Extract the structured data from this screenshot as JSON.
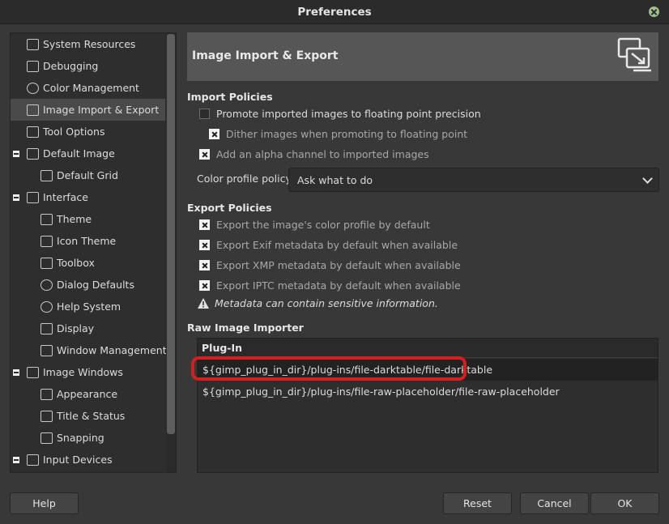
{
  "window": {
    "title": "Preferences"
  },
  "sidebar": {
    "items": [
      {
        "label": "System Resources"
      },
      {
        "label": "Debugging"
      },
      {
        "label": "Color Management"
      },
      {
        "label": "Image Import & Export"
      },
      {
        "label": "Tool Options"
      },
      {
        "label": "Default Image"
      },
      {
        "label": "Default Grid"
      },
      {
        "label": "Interface"
      },
      {
        "label": "Theme"
      },
      {
        "label": "Icon Theme"
      },
      {
        "label": "Toolbox"
      },
      {
        "label": "Dialog Defaults"
      },
      {
        "label": "Help System"
      },
      {
        "label": "Display"
      },
      {
        "label": "Window Management"
      },
      {
        "label": "Image Windows"
      },
      {
        "label": "Appearance"
      },
      {
        "label": "Title & Status"
      },
      {
        "label": "Snapping"
      },
      {
        "label": "Input Devices"
      }
    ],
    "selected": "Image Import & Export"
  },
  "page": {
    "title": "Image Import & Export",
    "import_policies": {
      "title": "Import Policies",
      "promote": {
        "label": "Promote imported images to floating point precision",
        "checked": false
      },
      "dither": {
        "label": "Dither images when promoting to floating point",
        "checked": true
      },
      "alpha": {
        "label": "Add an alpha channel to imported images",
        "checked": true
      },
      "color_profile_label": "Color profile policy:",
      "color_profile_value": "Ask what to do"
    },
    "export_policies": {
      "title": "Export Policies",
      "profile": {
        "label": "Export the image's color profile by default",
        "checked": true
      },
      "exif": {
        "label": "Export Exif metadata by default when available",
        "checked": true
      },
      "xmp": {
        "label": "Export XMP metadata by default when available",
        "checked": true
      },
      "iptc": {
        "label": "Export IPTC metadata by default when available",
        "checked": true
      },
      "warning": "Metadata can contain sensitive information."
    },
    "raw_importer": {
      "title": "Raw Image Importer",
      "column_header": "Plug-In",
      "rows": [
        "${gimp_plug_in_dir}/plug-ins/file-darktable/file-darktable",
        "${gimp_plug_in_dir}/plug-ins/file-raw-placeholder/file-raw-placeholder"
      ]
    }
  },
  "buttons": {
    "help": "Help",
    "reset": "Reset",
    "cancel": "Cancel",
    "ok": "OK"
  },
  "colors": {
    "background": "#383838",
    "header": "#565656",
    "highlight": "#d21f1f",
    "close": "#9ec08a"
  }
}
